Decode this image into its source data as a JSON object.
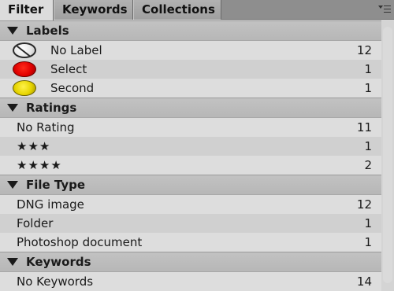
{
  "tabs": [
    {
      "label": "Filter",
      "active": true
    },
    {
      "label": "Keywords",
      "active": false
    },
    {
      "label": "Collections",
      "active": false
    }
  ],
  "sections": {
    "labels": {
      "title": "Labels",
      "items": [
        {
          "icon": "no-label-icon",
          "label": "No Label",
          "count": "12"
        },
        {
          "icon": "red-label-icon",
          "label": "Select",
          "count": "1"
        },
        {
          "icon": "yellow-label-icon",
          "label": "Second",
          "count": "1"
        }
      ]
    },
    "ratings": {
      "title": "Ratings",
      "items": [
        {
          "label": "No Rating",
          "count": "11"
        },
        {
          "label": "★★★",
          "count": "1"
        },
        {
          "label": "★★★★",
          "count": "2"
        }
      ]
    },
    "file_type": {
      "title": "File Type",
      "items": [
        {
          "label": "DNG image",
          "count": "12"
        },
        {
          "label": "Folder",
          "count": "1"
        },
        {
          "label": "Photoshop document",
          "count": "1"
        }
      ]
    },
    "keywords": {
      "title": "Keywords",
      "items": [
        {
          "label": "No Keywords",
          "count": "14"
        }
      ]
    }
  },
  "colors": {
    "label_red": "#e00000",
    "label_yellow": "#e6d400"
  }
}
